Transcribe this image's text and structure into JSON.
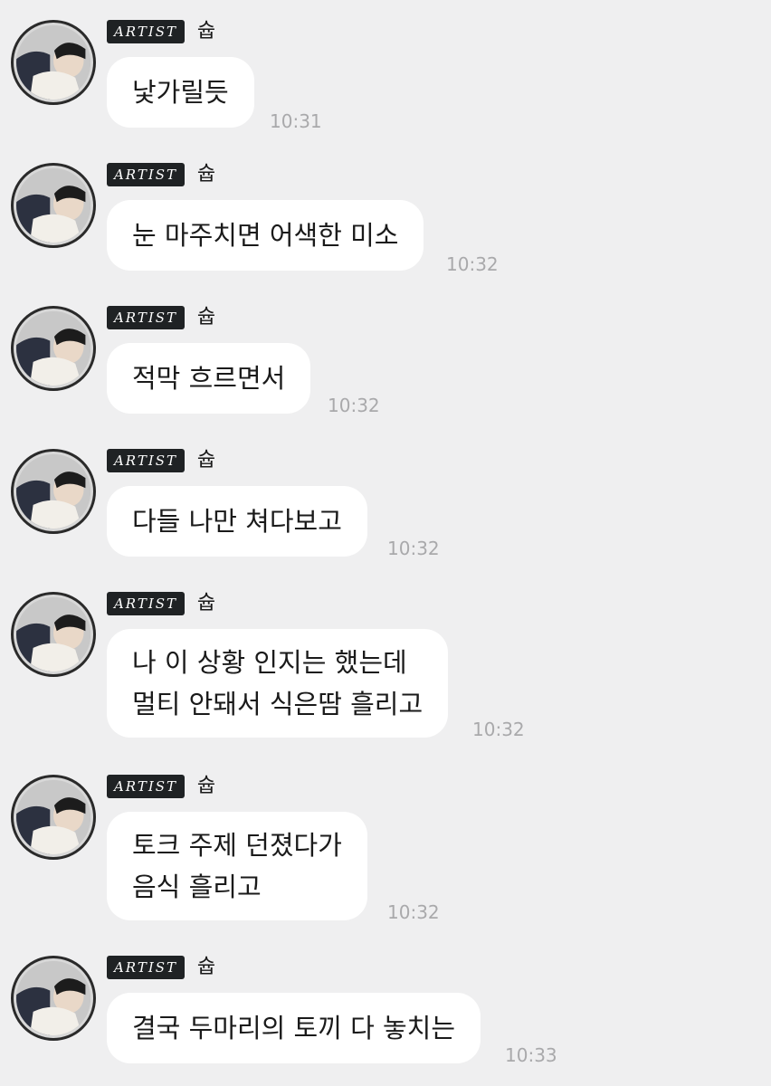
{
  "sender": {
    "badge": "ARTIST",
    "name": "슙"
  },
  "messages": [
    {
      "text": "낯가릴듯",
      "time": "10:31"
    },
    {
      "text": "눈 마주치면 어색한 미소",
      "time": "10:32"
    },
    {
      "text": "적막 흐르면서",
      "time": "10:32"
    },
    {
      "text": "다들 나만 쳐다보고",
      "time": "10:32"
    },
    {
      "text": "나 이 상황 인지는 했는데\n멀티 안돼서 식은땀 흘리고",
      "time": "10:32"
    },
    {
      "text": "토크 주제 던졌다가\n음식 흘리고",
      "time": "10:32"
    },
    {
      "text": "결국 두마리의 토끼 다 놓치는",
      "time": "10:33"
    }
  ]
}
